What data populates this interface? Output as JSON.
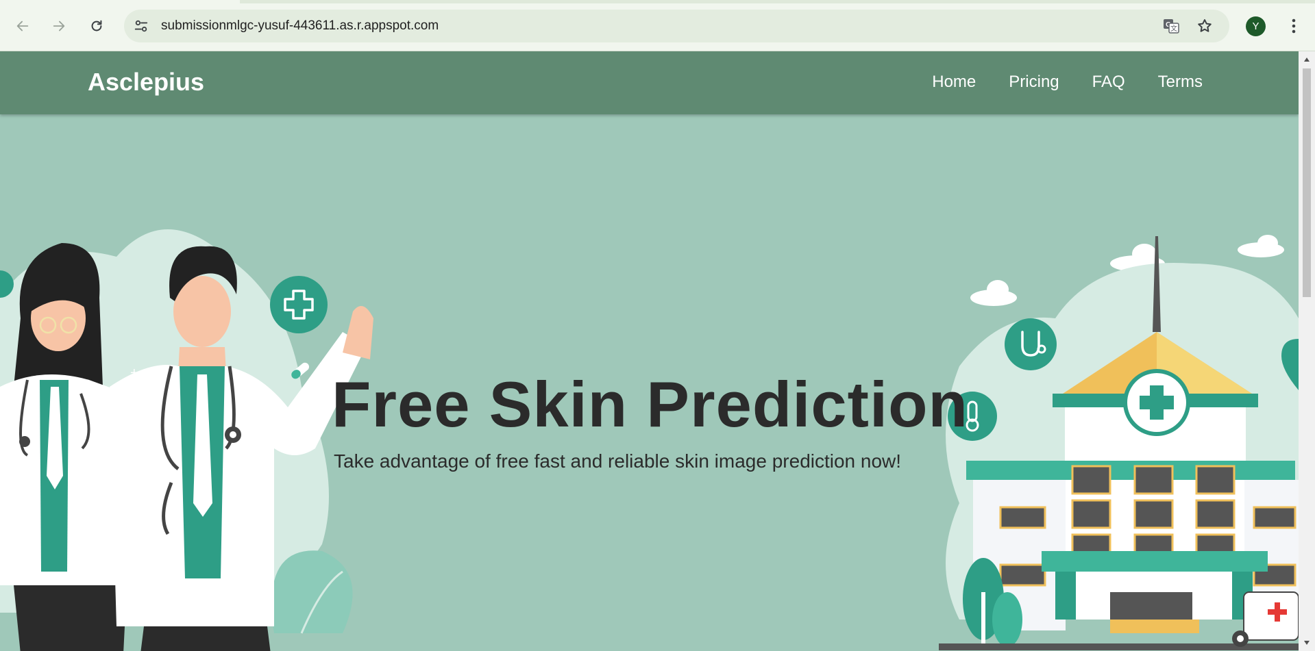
{
  "browser": {
    "url": "submissionmlgc-yusuf-443611.as.r.appspot.com",
    "profile_initial": "Y",
    "icons": {
      "back": "back-arrow-icon",
      "forward": "forward-arrow-icon",
      "reload": "reload-icon",
      "site_info": "site-info-icon",
      "translate": "translate-icon",
      "bookmark": "star-icon",
      "menu": "kebab-menu-icon"
    }
  },
  "site": {
    "brand": "Asclepius",
    "nav": [
      "Home",
      "Pricing",
      "FAQ",
      "Terms"
    ]
  },
  "hero": {
    "title": "Free Skin Prediction",
    "subtitle": "Take advantage of free fast and reliable skin image prediction now!"
  },
  "colors": {
    "nav_bar": "#5f8a72",
    "hero_bg": "#9fc8b9",
    "accent_teal": "#2e9e86",
    "text_dark": "#2b2b2b"
  }
}
